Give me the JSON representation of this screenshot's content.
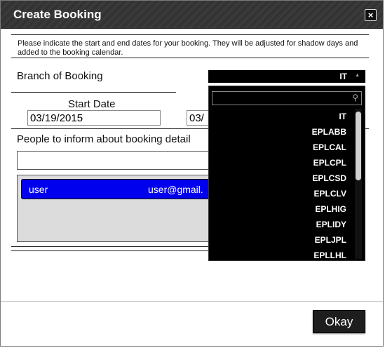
{
  "dialog": {
    "title": "Create Booking",
    "close_label": "×",
    "instructions": "Please indicate the start and end dates for your booking. They will be adjusted for shadow days and added to the booking calendar.",
    "okay_label": "Okay"
  },
  "branch": {
    "label": "Branch of Booking",
    "selected": "IT",
    "arrow": "▲",
    "search_icon": "⚲",
    "options": [
      "IT",
      "EPLABB",
      "EPLCAL",
      "EPLCPL",
      "EPLCSD",
      "EPLCLV",
      "EPLHIG",
      "EPLIDY",
      "EPLJPL",
      "EPLLHL"
    ]
  },
  "dates": {
    "start_label": "Start Date",
    "start_value": "03/19/2015",
    "end_value": "03/"
  },
  "people": {
    "label": "People to inform about booking detail",
    "input_value": "",
    "entries": [
      {
        "name": "user",
        "email": "user@gmail."
      }
    ]
  }
}
